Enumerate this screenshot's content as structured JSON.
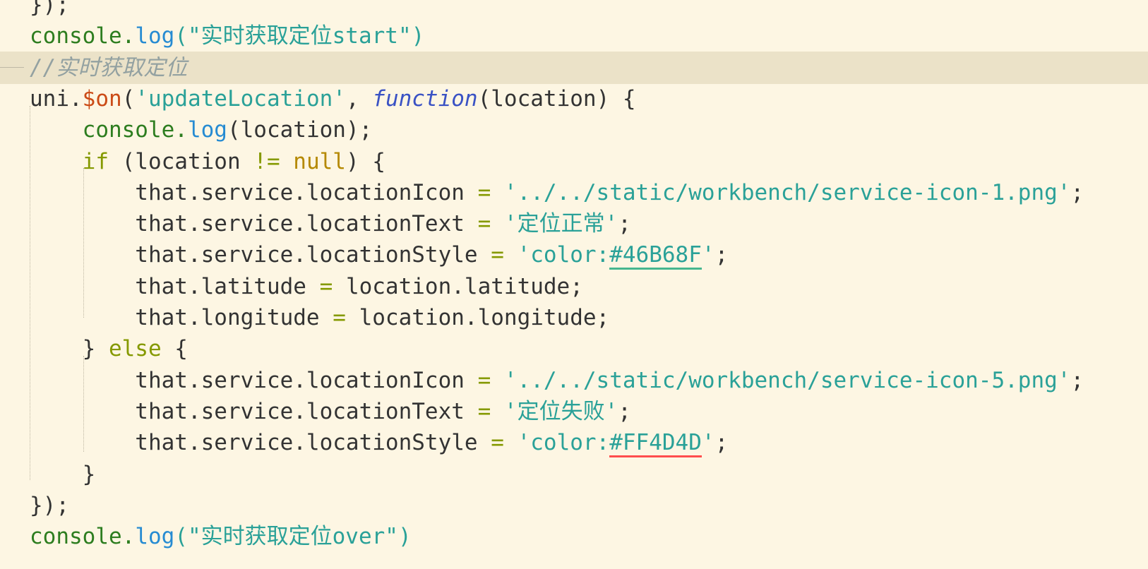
{
  "editor": {
    "lines": [
      {
        "tokens": [
          {
            "t": "});",
            "c": "plain"
          }
        ]
      },
      {
        "tokens": [
          {
            "t": "console.",
            "c": "fn"
          },
          {
            "t": "log",
            "c": "method"
          },
          {
            "t": "(\"实时获取定位start\")",
            "c": "str"
          }
        ]
      },
      {
        "current": true,
        "tokens": [
          {
            "t": "//实时获取定位",
            "c": "com"
          }
        ]
      },
      {
        "tokens": [
          {
            "t": "uni.",
            "c": "plain"
          },
          {
            "t": "$on",
            "c": "on"
          },
          {
            "t": "(",
            "c": "plain"
          },
          {
            "t": "'updateLocation'",
            "c": "str"
          },
          {
            "t": ", ",
            "c": "plain"
          },
          {
            "t": "function",
            "c": "func"
          },
          {
            "t": "(location) {",
            "c": "plain"
          }
        ]
      },
      {
        "tokens": [
          {
            "t": "    ",
            "c": "plain"
          },
          {
            "t": "console.",
            "c": "fn"
          },
          {
            "t": "log",
            "c": "method"
          },
          {
            "t": "(location);",
            "c": "plain"
          }
        ]
      },
      {
        "tokens": [
          {
            "t": "    ",
            "c": "plain"
          },
          {
            "t": "if",
            "c": "kw"
          },
          {
            "t": " (location ",
            "c": "plain"
          },
          {
            "t": "!=",
            "c": "kw"
          },
          {
            "t": " ",
            "c": "plain"
          },
          {
            "t": "null",
            "c": "null"
          },
          {
            "t": ") {",
            "c": "plain"
          }
        ]
      },
      {
        "tokens": [
          {
            "t": "        that.service.locationIcon ",
            "c": "plain"
          },
          {
            "t": "=",
            "c": "kw"
          },
          {
            "t": " ",
            "c": "plain"
          },
          {
            "t": "'../../static/workbench/service-icon-1.png'",
            "c": "str"
          },
          {
            "t": ";",
            "c": "plain"
          }
        ]
      },
      {
        "tokens": [
          {
            "t": "        that.service.locationText ",
            "c": "plain"
          },
          {
            "t": "=",
            "c": "kw"
          },
          {
            "t": " ",
            "c": "plain"
          },
          {
            "t": "'定位正常'",
            "c": "str"
          },
          {
            "t": ";",
            "c": "plain"
          }
        ]
      },
      {
        "tokens": [
          {
            "t": "        that.service.locationStyle ",
            "c": "plain"
          },
          {
            "t": "=",
            "c": "kw"
          },
          {
            "t": " ",
            "c": "plain"
          },
          {
            "t": "'color:",
            "c": "str"
          },
          {
            "t": "#46B68F",
            "c": "color-green"
          },
          {
            "t": "'",
            "c": "str"
          },
          {
            "t": ";",
            "c": "plain"
          }
        ]
      },
      {
        "tokens": [
          {
            "t": "        that.latitude ",
            "c": "plain"
          },
          {
            "t": "=",
            "c": "kw"
          },
          {
            "t": " location.latitude;",
            "c": "plain"
          }
        ]
      },
      {
        "tokens": [
          {
            "t": "        that.longitude ",
            "c": "plain"
          },
          {
            "t": "=",
            "c": "kw"
          },
          {
            "t": " location.longitude;",
            "c": "plain"
          }
        ]
      },
      {
        "tokens": [
          {
            "t": "    } ",
            "c": "plain"
          },
          {
            "t": "else",
            "c": "kw"
          },
          {
            "t": " {",
            "c": "plain"
          }
        ]
      },
      {
        "tokens": [
          {
            "t": "        that.service.locationIcon ",
            "c": "plain"
          },
          {
            "t": "=",
            "c": "kw"
          },
          {
            "t": " ",
            "c": "plain"
          },
          {
            "t": "'../../static/workbench/service-icon-5.png'",
            "c": "str"
          },
          {
            "t": ";",
            "c": "plain"
          }
        ]
      },
      {
        "tokens": [
          {
            "t": "        that.service.locationText ",
            "c": "plain"
          },
          {
            "t": "=",
            "c": "kw"
          },
          {
            "t": " ",
            "c": "plain"
          },
          {
            "t": "'定位失败'",
            "c": "str"
          },
          {
            "t": ";",
            "c": "plain"
          }
        ]
      },
      {
        "tokens": [
          {
            "t": "        that.service.locationStyle ",
            "c": "plain"
          },
          {
            "t": "=",
            "c": "kw"
          },
          {
            "t": " ",
            "c": "plain"
          },
          {
            "t": "'color:",
            "c": "str"
          },
          {
            "t": "#FF4D4D",
            "c": "color-red"
          },
          {
            "t": "'",
            "c": "str"
          },
          {
            "t": ";",
            "c": "plain"
          }
        ]
      },
      {
        "tokens": [
          {
            "t": "    }",
            "c": "plain"
          }
        ]
      },
      {
        "tokens": [
          {
            "t": "});",
            "c": "plain"
          }
        ]
      },
      {
        "tokens": [
          {
            "t": "console.",
            "c": "fn"
          },
          {
            "t": "log",
            "c": "method"
          },
          {
            "t": "(\"实时获取定位over\")",
            "c": "str"
          }
        ]
      }
    ]
  }
}
